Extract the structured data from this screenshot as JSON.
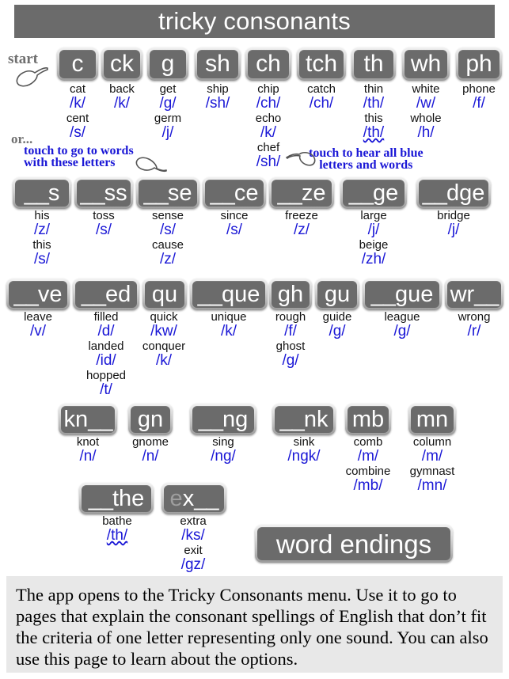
{
  "header": {
    "title": "tricky consonants"
  },
  "annotations": {
    "start": "start",
    "or": "or...",
    "touch_left_line1": "touch to go to words",
    "touch_left_line2": "with these letters",
    "touch_right_line1": "touch to hear all blue",
    "touch_right_line2": "letters and words"
  },
  "colors": {
    "tile_face": "#6b6b6b",
    "tile_bevel": "#dcdcdc",
    "sound_blue": "#1a17d6",
    "word_black": "#111111",
    "note_gray": "#6f6f6f",
    "footer_bg": "#e8e8e8",
    "title_bg": "#6b6b6b"
  },
  "rows": [
    {
      "name": "row-1",
      "tiles": [
        {
          "label": "c",
          "lead": "",
          "trail": "",
          "examples": [
            {
              "word": "cat",
              "sound": "/k/"
            },
            {
              "word": "cent",
              "sound": "/s/"
            }
          ]
        },
        {
          "label": "ck",
          "lead": "",
          "trail": "",
          "examples": [
            {
              "word": "back",
              "sound": "/k/"
            }
          ]
        },
        {
          "label": "g",
          "lead": "",
          "trail": "",
          "examples": [
            {
              "word": "get",
              "sound": "/g/"
            },
            {
              "word": "germ",
              "sound": "/j/"
            }
          ]
        },
        {
          "label": "sh",
          "lead": "",
          "trail": "",
          "examples": [
            {
              "word": "ship",
              "sound": "/sh/"
            }
          ]
        },
        {
          "label": "ch",
          "lead": "",
          "trail": "",
          "examples": [
            {
              "word": "chip",
              "sound": "/ch/"
            },
            {
              "word": "echo",
              "sound": "/k/"
            },
            {
              "word": "chef",
              "sound": "/sh/"
            }
          ]
        },
        {
          "label": "tch",
          "lead": "",
          "trail": "",
          "examples": [
            {
              "word": "catch",
              "sound": "/ch/"
            }
          ]
        },
        {
          "label": "th",
          "lead": "",
          "trail": "",
          "examples": [
            {
              "word": "thin",
              "sound": "/th/"
            },
            {
              "word": "this",
              "sound": "/th/",
              "wavy": true
            }
          ]
        },
        {
          "label": "wh",
          "lead": "",
          "trail": "",
          "examples": [
            {
              "word": "white",
              "sound": "/w/"
            },
            {
              "word": "whole",
              "sound": "/h/"
            }
          ]
        },
        {
          "label": "ph",
          "lead": "",
          "trail": "",
          "examples": [
            {
              "word": "phone",
              "sound": "/f/"
            }
          ]
        }
      ]
    },
    {
      "name": "row-2",
      "tiles": [
        {
          "label": "s",
          "lead": "__",
          "trail": "",
          "examples": [
            {
              "word": "his",
              "sound": "/z/"
            },
            {
              "word": "this",
              "sound": "/s/"
            }
          ]
        },
        {
          "label": "ss",
          "lead": "__",
          "trail": "",
          "examples": [
            {
              "word": "toss",
              "sound": "/s/"
            }
          ]
        },
        {
          "label": "se",
          "lead": "__",
          "trail": "",
          "examples": [
            {
              "word": "sense",
              "sound": "/s/"
            },
            {
              "word": "cause",
              "sound": "/z/"
            }
          ]
        },
        {
          "label": "ce",
          "lead": "__",
          "trail": "",
          "examples": [
            {
              "word": "since",
              "sound": "/s/"
            }
          ]
        },
        {
          "label": "ze",
          "lead": "__",
          "trail": "",
          "examples": [
            {
              "word": "freeze",
              "sound": "/z/"
            }
          ]
        },
        {
          "label": "ge",
          "lead": "__",
          "trail": "",
          "examples": [
            {
              "word": "large",
              "sound": "/j/"
            },
            {
              "word": "beige",
              "sound": "/zh/"
            }
          ]
        },
        {
          "label": "dge",
          "lead": "__",
          "trail": "",
          "examples": [
            {
              "word": "bridge",
              "sound": "/j/"
            }
          ]
        }
      ]
    },
    {
      "name": "row-3",
      "tiles": [
        {
          "label": "ve",
          "lead": "__",
          "trail": "",
          "examples": [
            {
              "word": "leave",
              "sound": "/v/"
            }
          ]
        },
        {
          "label": "ed",
          "lead": "__",
          "trail": "",
          "examples": [
            {
              "word": "filled",
              "sound": "/d/"
            },
            {
              "word": "landed",
              "sound": "/id/"
            },
            {
              "word": "hopped",
              "sound": "/t/"
            }
          ]
        },
        {
          "label": "qu",
          "lead": "",
          "trail": "",
          "examples": [
            {
              "word": "quick",
              "sound": "/kw/"
            },
            {
              "word": "conquer",
              "sound": "/k/"
            }
          ]
        },
        {
          "label": "que",
          "lead": "__",
          "trail": "",
          "examples": [
            {
              "word": "unique",
              "sound": "/k/"
            }
          ]
        },
        {
          "label": "gh",
          "lead": "",
          "trail": "",
          "examples": [
            {
              "word": "rough",
              "sound": "/f/"
            },
            {
              "word": "ghost",
              "sound": "/g/"
            }
          ]
        },
        {
          "label": "gu",
          "lead": "",
          "trail": "",
          "examples": [
            {
              "word": "guide",
              "sound": "/g/"
            }
          ]
        },
        {
          "label": "gue",
          "lead": "__",
          "trail": "",
          "examples": [
            {
              "word": "league",
              "sound": "/g/"
            }
          ]
        },
        {
          "label": "wr",
          "lead": "",
          "trail": "__",
          "examples": [
            {
              "word": "wrong",
              "sound": "/r/"
            }
          ]
        }
      ]
    },
    {
      "name": "row-4",
      "tiles": [
        {
          "label": "kn",
          "lead": "",
          "trail": "__",
          "examples": [
            {
              "word": "knot",
              "sound": "/n/"
            }
          ]
        },
        {
          "label": "gn",
          "lead": "",
          "trail": "",
          "examples": [
            {
              "word": "gnome",
              "sound": "/n/"
            }
          ]
        },
        {
          "label": "ng",
          "lead": "__",
          "trail": "",
          "examples": [
            {
              "word": "sing",
              "sound": "/ng/"
            }
          ]
        },
        {
          "label": "nk",
          "lead": "__",
          "trail": "",
          "examples": [
            {
              "word": "sink",
              "sound": "/ngk/"
            }
          ]
        },
        {
          "label": "mb",
          "lead": "",
          "trail": "",
          "examples": [
            {
              "word": "comb",
              "sound": "/m/"
            },
            {
              "word": "combine",
              "sound": "/mb/"
            }
          ]
        },
        {
          "label": "mn",
          "lead": "",
          "trail": "",
          "examples": [
            {
              "word": "column",
              "sound": "/m/"
            },
            {
              "word": "gymnast",
              "sound": "/mn/"
            }
          ]
        }
      ]
    },
    {
      "name": "row-5",
      "tiles": [
        {
          "label": "the",
          "lead": "__",
          "trail": "",
          "examples": [
            {
              "word": "bathe",
              "sound": "/th/",
              "wavy": true
            }
          ]
        },
        {
          "label": "x",
          "lead": "e",
          "trail": "__",
          "dim_lead": true,
          "examples": [
            {
              "word": "extra",
              "sound": "/ks/"
            },
            {
              "word": "exit",
              "sound": "/gz/"
            }
          ]
        }
      ]
    }
  ],
  "word_endings_button": {
    "label": "word endings"
  },
  "footer": {
    "text": "The app opens to the Tricky Consonants menu. Use it to go to pages that explain the consonant spellings of English that don’t fit the criteria of one letter representing only one sound. You can also use this page to learn about the options."
  }
}
